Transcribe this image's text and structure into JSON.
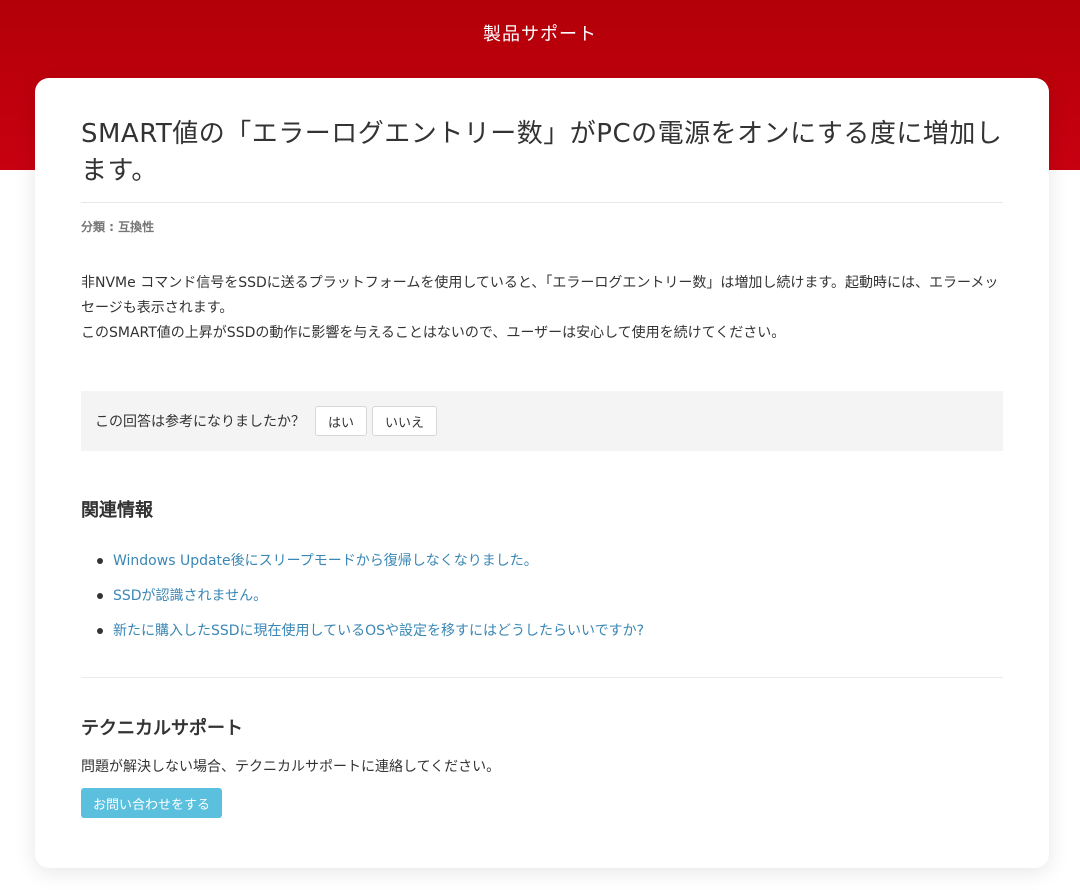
{
  "header": {
    "site_title": "製品サポート"
  },
  "article": {
    "title": "SMART値の「エラーログエントリー数」がPCの電源をオンにする度に増加します。",
    "category": "分類 : 互換性",
    "paragraph1": "非NVMe コマンド信号をSSDに送るプラットフォームを使用していると、「エラーログエントリー数」は増加し続けます。起動時には、エラーメッセージも表示されます。",
    "paragraph2": "このSMART値の上昇がSSDの動作に影響を与えることはないので、ユーザーは安心して使用を続けてください。"
  },
  "feedback": {
    "question": "この回答は参考になりましたか？",
    "yes_label": "はい",
    "no_label": "いいえ"
  },
  "related": {
    "heading": "関連情報",
    "links": [
      "Windows Update後にスリープモードから復帰しなくなりました。",
      "SSDが認識されません。",
      "新たに購入したSSDに現在使用しているOSや設定を移すにはどうしたらいいですか?"
    ]
  },
  "support": {
    "heading": "テクニカルサポート",
    "text": "問題が解決しない場合、テクニカルサポートに連絡してください。",
    "contact_label": "お問い合わせをする"
  },
  "colors": {
    "brand_red": "#c00010",
    "link_blue": "#3a87b5",
    "contact_button": "#5bc0de"
  }
}
